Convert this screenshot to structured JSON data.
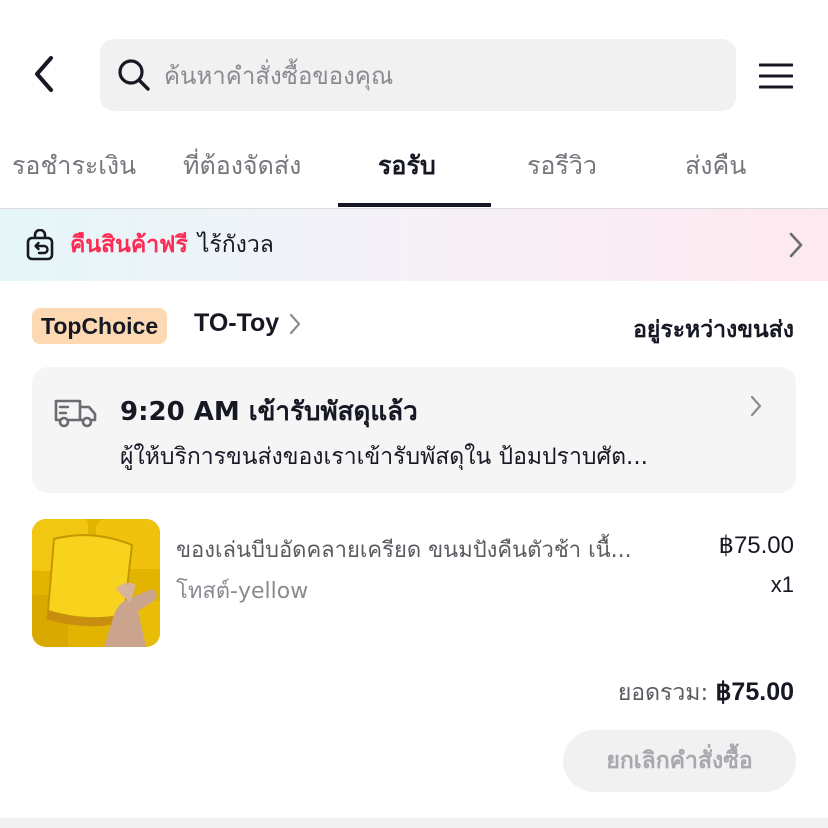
{
  "header": {
    "search_placeholder": "ค้นหาคำสั่งซื้อของคุณ"
  },
  "tabs": [
    {
      "label": "รอชำระเงิน",
      "active": false
    },
    {
      "label": "ที่ต้องจัดส่ง",
      "active": false
    },
    {
      "label": "รอรับ",
      "active": true
    },
    {
      "label": "รอรีวิว",
      "active": false
    },
    {
      "label": "ส่งคืน",
      "active": false
    }
  ],
  "banner": {
    "highlight": "คืนสินค้าฟรี",
    "text": "ไร้กังวล",
    "highlight_color": "#fe2c55"
  },
  "order": {
    "badge": "TopChoice",
    "shop_name": "TO-Toy",
    "status": "อยู่ระหว่างขนส่ง",
    "tracking": {
      "title": "9:20 AM เข้ารับพัสดุแล้ว",
      "detail": "ผู้ให้บริการขนส่งของเราเข้ารับพัสดุใน ป้อมปราบศัต..."
    },
    "product": {
      "name": "ของเล่นบีบอัดคลายเครียด ขนมปังคืนตัวช้า เนื้...",
      "variant": "โทสต์-yellow",
      "price": "฿75.00",
      "qty": "x1"
    },
    "total_label": "ยอดรวม:",
    "total_value": "฿75.00",
    "cancel_label": "ยกเลิกคำสั่งซื้อ"
  },
  "icons": {
    "back": "back-arrow-icon",
    "search": "search-icon",
    "menu": "menu-icon",
    "return": "return-bag-icon",
    "truck": "delivery-truck-icon",
    "chevron": "chevron-right-icon"
  }
}
